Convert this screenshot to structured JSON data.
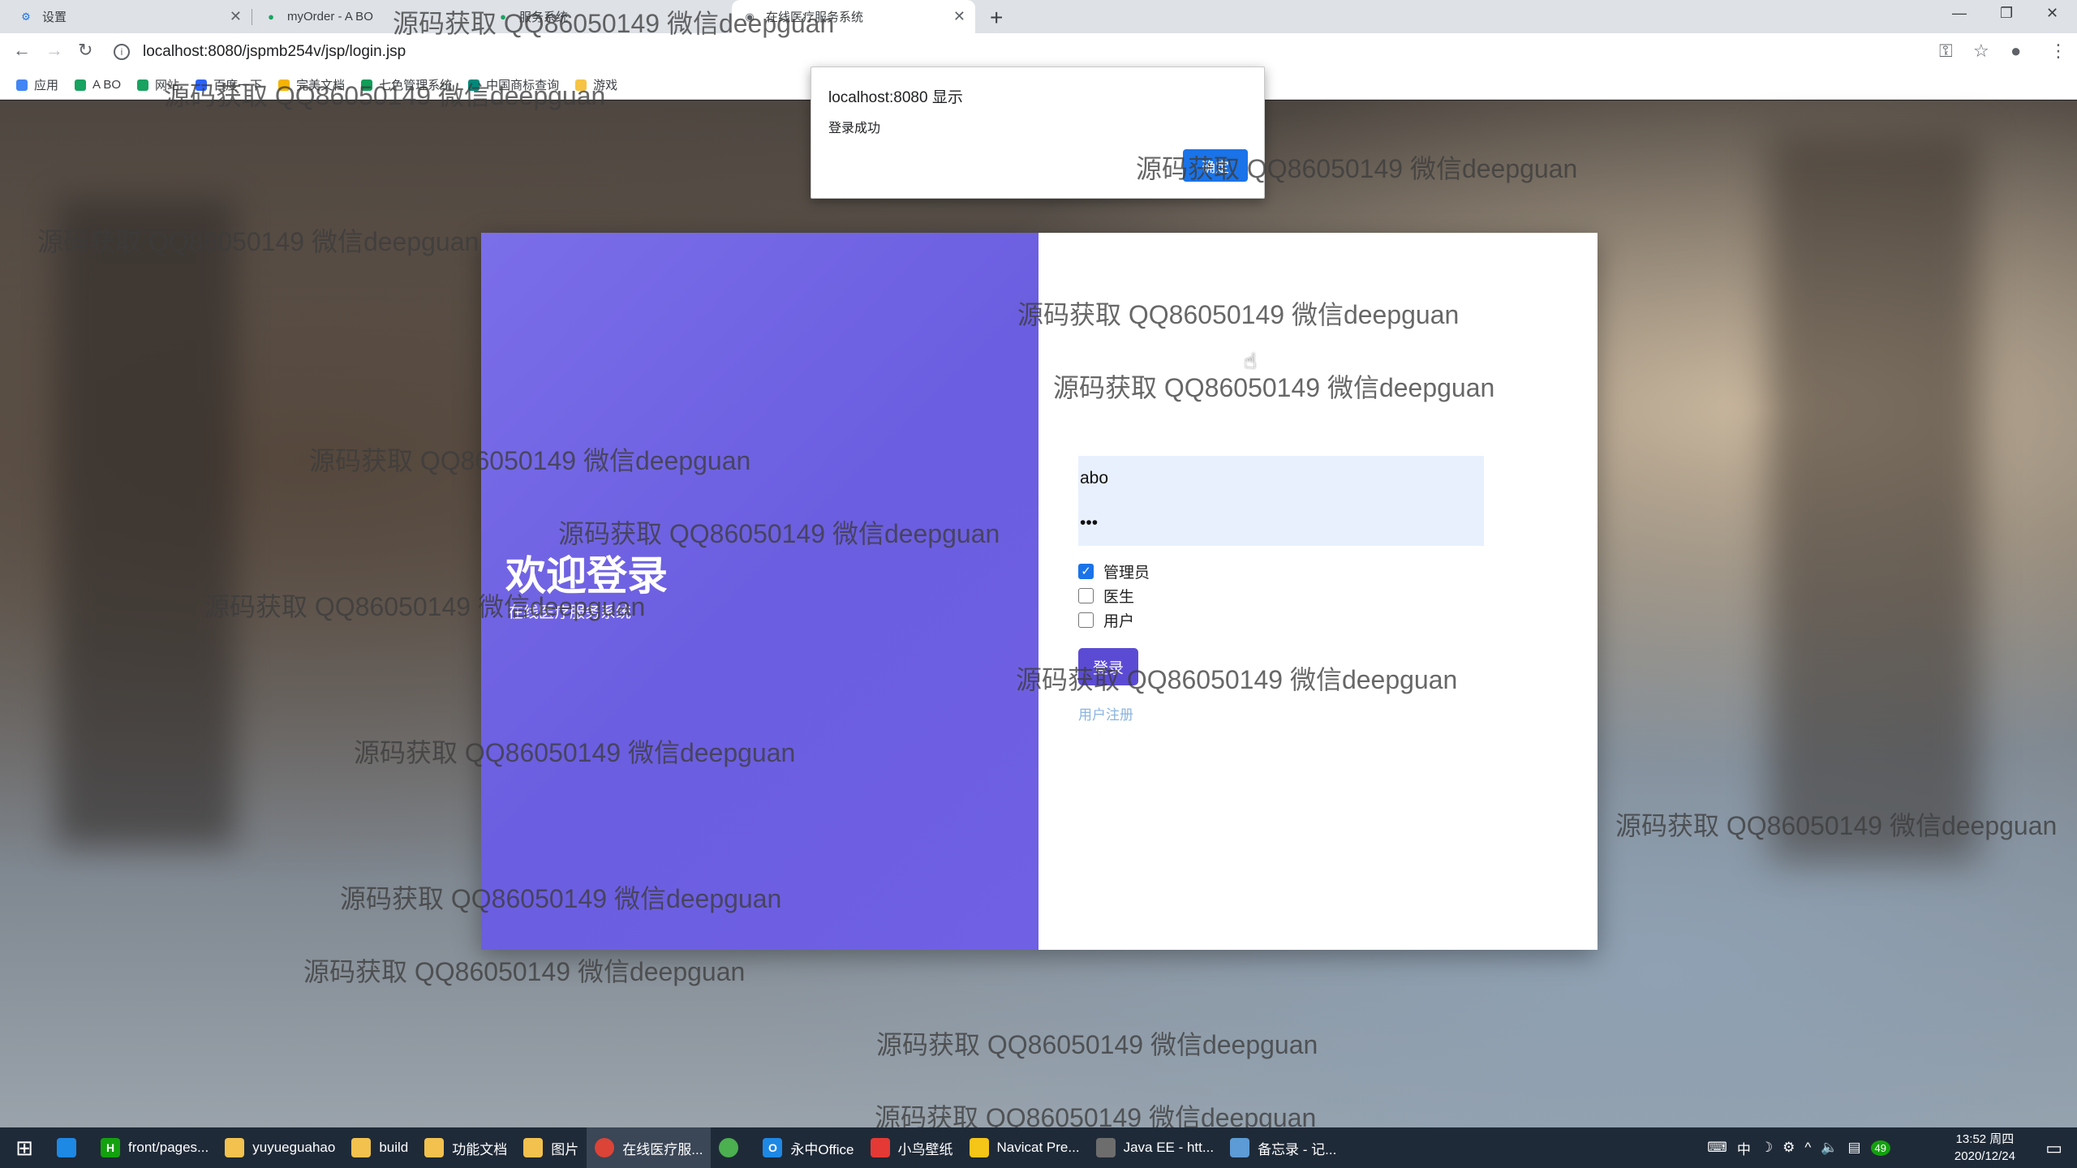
{
  "browser": {
    "tabs": [
      {
        "title": "设置",
        "icon": "gear-icon"
      },
      {
        "title": "myOrder - A BO",
        "icon": "site-icon"
      },
      {
        "title": "服务系统",
        "icon": "site-icon"
      },
      {
        "title": "在线医疗服务系统",
        "icon": "globe-icon",
        "active": true
      }
    ],
    "url": "localhost:8080/jspmb254v/jsp/login.jsp",
    "bookmarks": [
      "应用",
      "A BO",
      "网站",
      "百度一下",
      "完美文档",
      "七色管理系统",
      "中国商标查询",
      "游戏"
    ]
  },
  "dialog": {
    "title": "localhost:8080 显示",
    "message": "登录成功",
    "ok_label": "确定"
  },
  "login": {
    "welcome": "欢迎登录",
    "subtitle": "在线医疗服务系统",
    "username": "abo",
    "password": "•••",
    "roles": [
      {
        "label": "管理员",
        "checked": true
      },
      {
        "label": "医生",
        "checked": false
      },
      {
        "label": "用户",
        "checked": false
      }
    ],
    "login_label": "登录",
    "register_label": "用户注册"
  },
  "watermark": "源码获取 QQ86050149 微信deepguan",
  "taskbar": {
    "items": [
      {
        "label": "front/pages...",
        "color": "#13a10e",
        "glyph": "H"
      },
      {
        "label": "yuyueguahao",
        "color": "#f2c14e",
        "glyph": ""
      },
      {
        "label": "build",
        "color": "#f2c14e",
        "glyph": ""
      },
      {
        "label": "功能文档",
        "color": "#f2c14e",
        "glyph": ""
      },
      {
        "label": "图片",
        "color": "#f2c14e",
        "glyph": ""
      },
      {
        "label": "在线医疗服...",
        "color": "#db4437",
        "glyph": "",
        "active": true
      },
      {
        "label": "",
        "color": "#4caf50",
        "glyph": ""
      },
      {
        "label": "永中Office",
        "color": "#1e88e5",
        "glyph": "O"
      },
      {
        "label": "小鸟壁纸",
        "color": "#e53935",
        "glyph": ""
      },
      {
        "label": "Navicat Pre...",
        "color": "#f5c518",
        "glyph": ""
      },
      {
        "label": "Java EE - htt...",
        "color": "#6d6d6d",
        "glyph": ""
      },
      {
        "label": "备忘录 - 记...",
        "color": "#5c9bd5",
        "glyph": ""
      }
    ],
    "tray_text": "中",
    "time": "13:52 周四",
    "date": "2020/12/24",
    "badge": "49"
  }
}
